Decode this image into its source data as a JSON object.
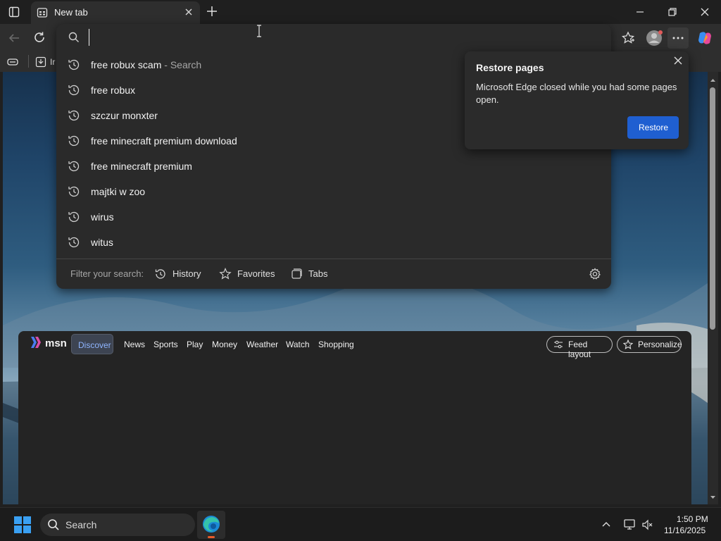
{
  "tab": {
    "title": "New tab"
  },
  "favorites_bar": {
    "first_item_partial": "Ir"
  },
  "address_bar": {
    "value": "",
    "placeholder": ""
  },
  "suggestions": [
    {
      "text": "free robux scam",
      "hint": "- Search"
    },
    {
      "text": "free robux",
      "hint": ""
    },
    {
      "text": "szczur monxter",
      "hint": ""
    },
    {
      "text": "free minecraft premium download",
      "hint": ""
    },
    {
      "text": "free minecraft premium",
      "hint": ""
    },
    {
      "text": "majtki w zoo",
      "hint": ""
    },
    {
      "text": "wirus",
      "hint": ""
    },
    {
      "text": "witus",
      "hint": ""
    }
  ],
  "filter": {
    "label": "Filter your search:",
    "options": [
      "History",
      "Favorites",
      "Tabs"
    ]
  },
  "restore_popup": {
    "title": "Restore pages",
    "body": "Microsoft Edge closed while you had some pages open.",
    "button": "Restore"
  },
  "msn": {
    "logo": "msn",
    "nav": [
      "Discover",
      "News",
      "Sports",
      "Play",
      "Money",
      "Weather",
      "Watch",
      "Shopping"
    ],
    "active": "Discover",
    "feed_layout": "Feed layout",
    "personalize": "Personalize"
  },
  "taskbar": {
    "search_label": "Search",
    "time": "1:50 PM",
    "date": "11/16/2025"
  },
  "colors": {
    "accent_button": "#1f5fd1",
    "panel": "#2a2a2a",
    "taskbar": "#1c1c1c"
  }
}
